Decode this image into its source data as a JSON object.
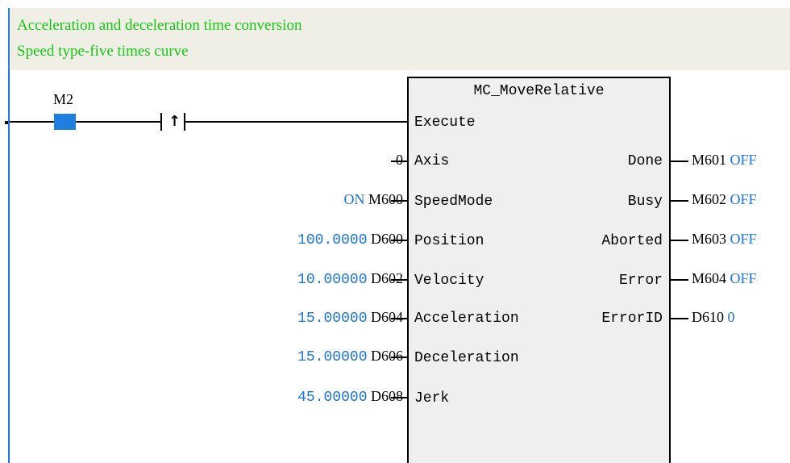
{
  "comment": {
    "line1": "Acceleration and deceleration time conversion",
    "line2": "Speed type-five times curve"
  },
  "contact": {
    "label": "M2",
    "edge_symbol": "↑"
  },
  "function_block": {
    "name": "MC_MoveRelative",
    "inputs": [
      {
        "pin": "Execute",
        "value": "",
        "var": ""
      },
      {
        "pin": "Axis",
        "value": "",
        "var": "0"
      },
      {
        "pin": "SpeedMode",
        "value": "ON",
        "var": "M600"
      },
      {
        "pin": "Position",
        "value": "100.0000",
        "var": "D600"
      },
      {
        "pin": "Velocity",
        "value": "10.00000",
        "var": "D602"
      },
      {
        "pin": "Acceleration",
        "value": "15.00000",
        "var": "D604"
      },
      {
        "pin": "Deceleration",
        "value": "15.00000",
        "var": "D606"
      },
      {
        "pin": "Jerk",
        "value": "45.00000",
        "var": "D608"
      }
    ],
    "outputs": [
      {
        "pin": "Done",
        "var": "M601",
        "value": "OFF"
      },
      {
        "pin": "Busy",
        "var": "M602",
        "value": "OFF"
      },
      {
        "pin": "Aborted",
        "var": "M603",
        "value": "OFF"
      },
      {
        "pin": "Error",
        "var": "M604",
        "value": "OFF"
      },
      {
        "pin": "ErrorID",
        "var": "D610",
        "value": "0"
      }
    ]
  },
  "colors": {
    "comment_text": "#14c814",
    "comment_bg": "#efefe5",
    "value_blue": "#1a73e8",
    "contact_fill": "#1e7fe0",
    "block_bg": "#efefef"
  }
}
